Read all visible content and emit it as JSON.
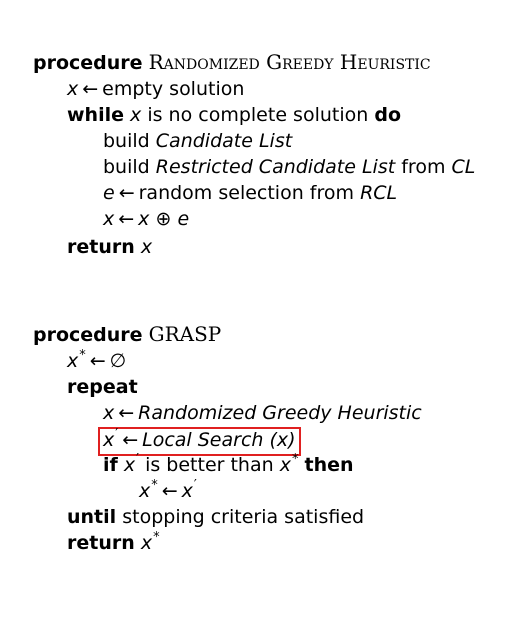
{
  "proc1": {
    "keyword": "procedure",
    "name": "Randomized Greedy Heuristic",
    "lines": {
      "init_var": "x",
      "init_rhs": "empty solution",
      "while_kw": "while",
      "while_var": "x",
      "while_cond": "is no complete solution",
      "do_kw": "do",
      "build1_verb": "build",
      "build1_obj": "Candidate List",
      "build2_verb": "build",
      "build2_obj": "Restricted Candidate List",
      "build2_from": "from",
      "build2_src": "CL",
      "sel_var": "e",
      "sel_rhs": "random selection from",
      "sel_src": "RCL",
      "add_lhs": "x",
      "add_a": "x",
      "add_op": "⊕",
      "add_b": "e",
      "return_kw": "return",
      "return_var": "x"
    }
  },
  "proc2": {
    "keyword": "procedure",
    "name": "GRASP",
    "lines": {
      "init_var": "x",
      "init_sup": "*",
      "init_rhs": "∅",
      "repeat_kw": "repeat",
      "rgh_var": "x",
      "rgh_rhs": "Randomized Greedy Heuristic",
      "ls_var": "x",
      "ls_sup": "′",
      "ls_rhs": "Local Search (x)",
      "if_kw": "if",
      "if_var": "x",
      "if_sup": "′",
      "if_cond": "is better than",
      "if_var2": "x",
      "if_sup2": "*",
      "then_kw": "then",
      "assign_var": "x",
      "assign_sup": "*",
      "assign_rhs_var": "x",
      "assign_rhs_sup": "′",
      "until_kw": "until",
      "until_cond": "stopping criteria satisfied",
      "return_kw": "return",
      "return_var": "x",
      "return_sup": "*"
    }
  },
  "symbols": {
    "arrow": "←"
  },
  "colors": {
    "text": "#000000",
    "highlight_border": "#e02020"
  }
}
